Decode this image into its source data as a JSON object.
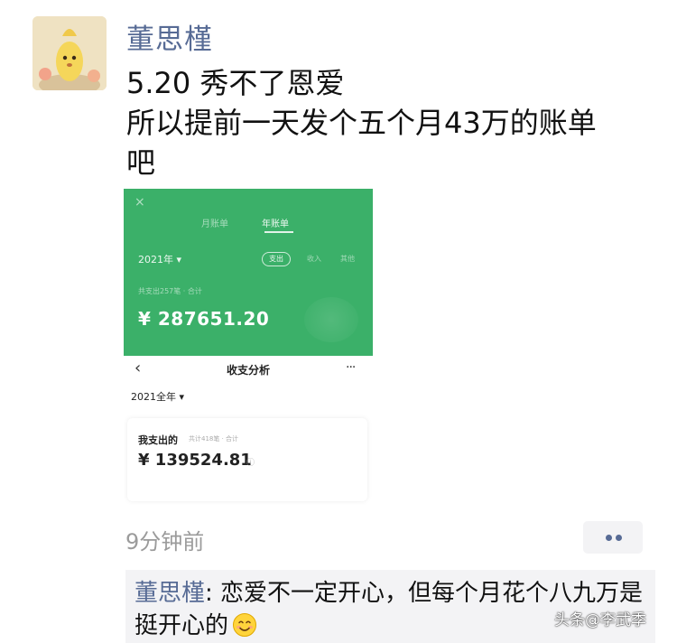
{
  "post": {
    "author": "董思槿",
    "text_lines": [
      "5.20 秀不了恩爱",
      "所以提前一天发个五个月43万的账单",
      "吧"
    ],
    "timestamp": "9分钟前"
  },
  "attachment": {
    "top_panel": {
      "close_glyph": "×",
      "tab_month": "月账单",
      "tab_year": "年账单",
      "year_selector": "2021年",
      "chip_label": "支出",
      "option_1": "收入",
      "option_2": "其他",
      "subtitle": "共支出257笔 · 合计",
      "amount": "¥ 287651.20"
    },
    "analysis": {
      "back_glyph": "‹",
      "title": "收支分析",
      "more_glyph": "···",
      "year_selector": "2021全年",
      "card_title": "我支出的",
      "card_sub": "共计418笔 · 合计",
      "amount": "¥ 139524.81",
      "info_glyph": "ⓘ"
    }
  },
  "comment": {
    "author": "董思槿",
    "separator": ": ",
    "text": "恋爱不一定开心，但每个月花个八九万是挺开心的"
  },
  "watermark": "头条@李武季",
  "colors": {
    "link": "#576b95",
    "green": "#3bb069",
    "comment_bg": "#f3f3f5"
  }
}
